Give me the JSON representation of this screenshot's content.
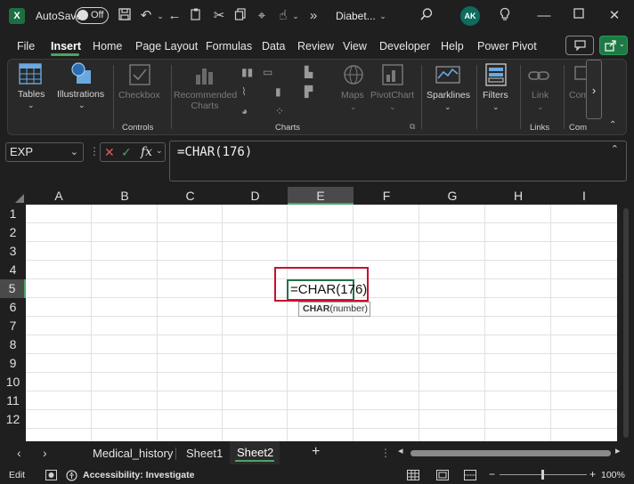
{
  "titlebar": {
    "app_icon": "X",
    "autosave_label": "AutoSave",
    "autosave_state": "Off",
    "file_name": "Diabet...",
    "overflow": "»",
    "user_initials": "AK"
  },
  "menu": {
    "tabs": [
      "File",
      "Insert",
      "Home",
      "Page Layout",
      "Formulas",
      "Data",
      "Review",
      "View",
      "Developer",
      "Help",
      "Power Pivot"
    ],
    "active_tab": "Insert"
  },
  "ribbon": {
    "tables": "Tables",
    "illustrations": "Illustrations",
    "checkbox": "Checkbox",
    "recommended_charts": "Recommended Charts",
    "maps": "Maps",
    "pivotchart": "PivotChart",
    "sparklines": "Sparklines",
    "filters": "Filters",
    "link": "Link",
    "comments": "Com",
    "controls_group": "Controls",
    "charts_group": "Charts",
    "links_group": "Links",
    "comments_group": "Com"
  },
  "formula_bar": {
    "name_box": "EXP",
    "fx": "fx",
    "formula": "=CHAR(176)"
  },
  "grid": {
    "columns": [
      "A",
      "B",
      "C",
      "D",
      "E",
      "F",
      "G",
      "H",
      "I"
    ],
    "selected_column": "E",
    "rows": [
      "1",
      "2",
      "3",
      "4",
      "5",
      "6",
      "7",
      "8",
      "9",
      "10",
      "11",
      "12"
    ],
    "selected_row": "5",
    "edit_text": "=CHAR(176)",
    "tooltip_fn": "CHAR",
    "tooltip_args": "(number)"
  },
  "sheets": {
    "tabs": [
      "Medical_history",
      "Sheet1",
      "Sheet2"
    ],
    "active": "Sheet2",
    "add": "+"
  },
  "status": {
    "mode": "Edit",
    "accessibility": "Accessibility: Investigate",
    "zoom": "100%"
  },
  "colors": {
    "accent_green": "#4aa564",
    "excel_green": "#217346",
    "highlight_red": "#c8102e"
  }
}
